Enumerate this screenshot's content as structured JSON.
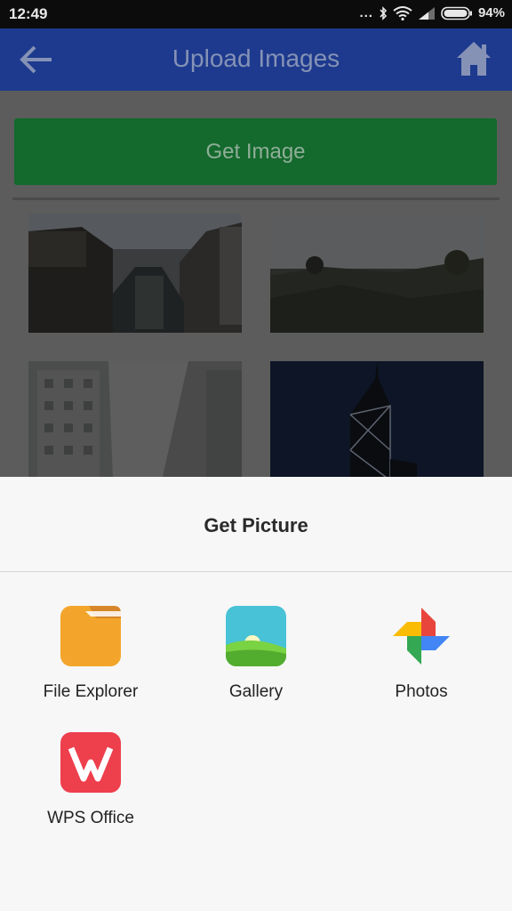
{
  "status_bar": {
    "time": "12:49",
    "dots": "...",
    "battery_percent": "94%"
  },
  "app_bar": {
    "title": "Upload Images",
    "back_icon": "arrow-left-icon",
    "home_icon": "home-icon"
  },
  "main": {
    "get_image_label": "Get Image",
    "thumbnails": [
      {
        "name": "canal-town-photo"
      },
      {
        "name": "hill-city-view-photo"
      },
      {
        "name": "apartment-buildings-photo"
      },
      {
        "name": "tower-night-photo"
      }
    ]
  },
  "sheet": {
    "title": "Get Picture",
    "apps": [
      {
        "label": "File Explorer",
        "icon": "folder-icon"
      },
      {
        "label": "Gallery",
        "icon": "gallery-icon"
      },
      {
        "label": "Photos",
        "icon": "pinwheel-icon"
      },
      {
        "label": "WPS Office",
        "icon": "wps-icon"
      }
    ]
  }
}
